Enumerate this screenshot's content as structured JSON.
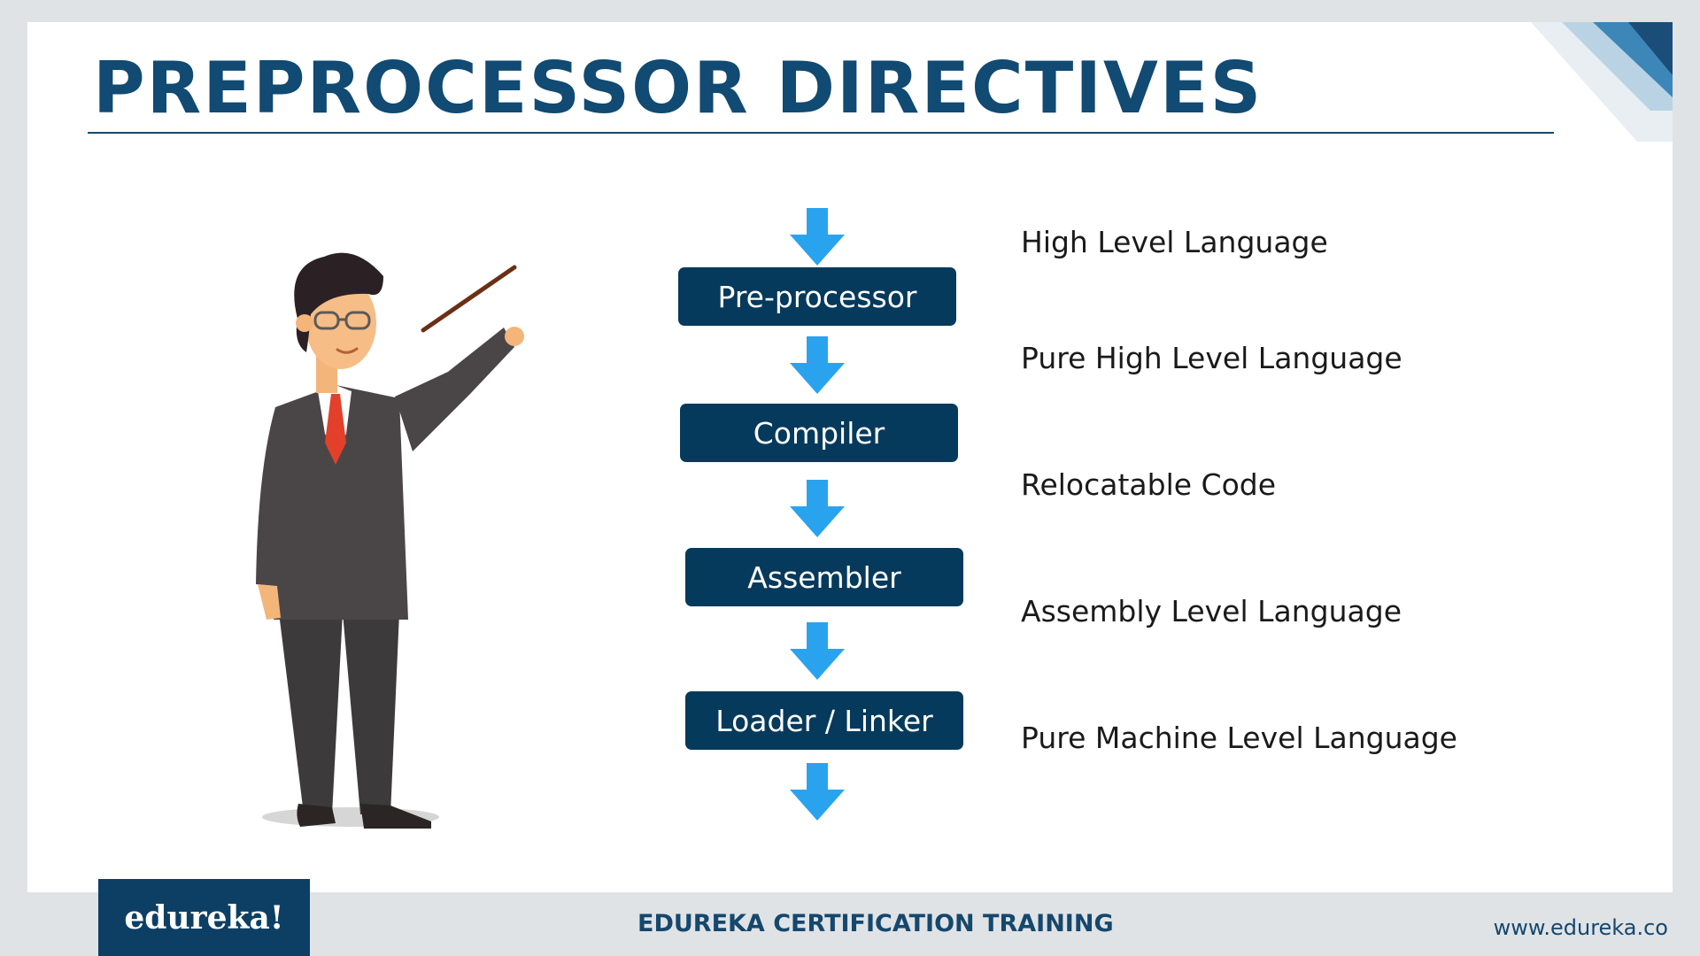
{
  "slide": {
    "title": "PREPROCESSOR DIRECTIVES"
  },
  "flow": {
    "steps": [
      {
        "label": "Pre-processor"
      },
      {
        "label": "Compiler"
      },
      {
        "label": "Assembler"
      },
      {
        "label": "Loader / Linker"
      }
    ],
    "stage_labels": [
      "High Level Language",
      "Pure High Level Language",
      "Relocatable Code",
      "Assembly Level Language",
      "Pure Machine Level Language"
    ]
  },
  "footer": {
    "logo_text": "edureka!",
    "center_text": "EDUREKA CERTIFICATION TRAINING",
    "website": "www.edureka.co"
  },
  "colors": {
    "title": "#114a72",
    "box": "#063a5c",
    "arrow": "#2aa3ee",
    "logo_bg": "#0d3f65"
  }
}
